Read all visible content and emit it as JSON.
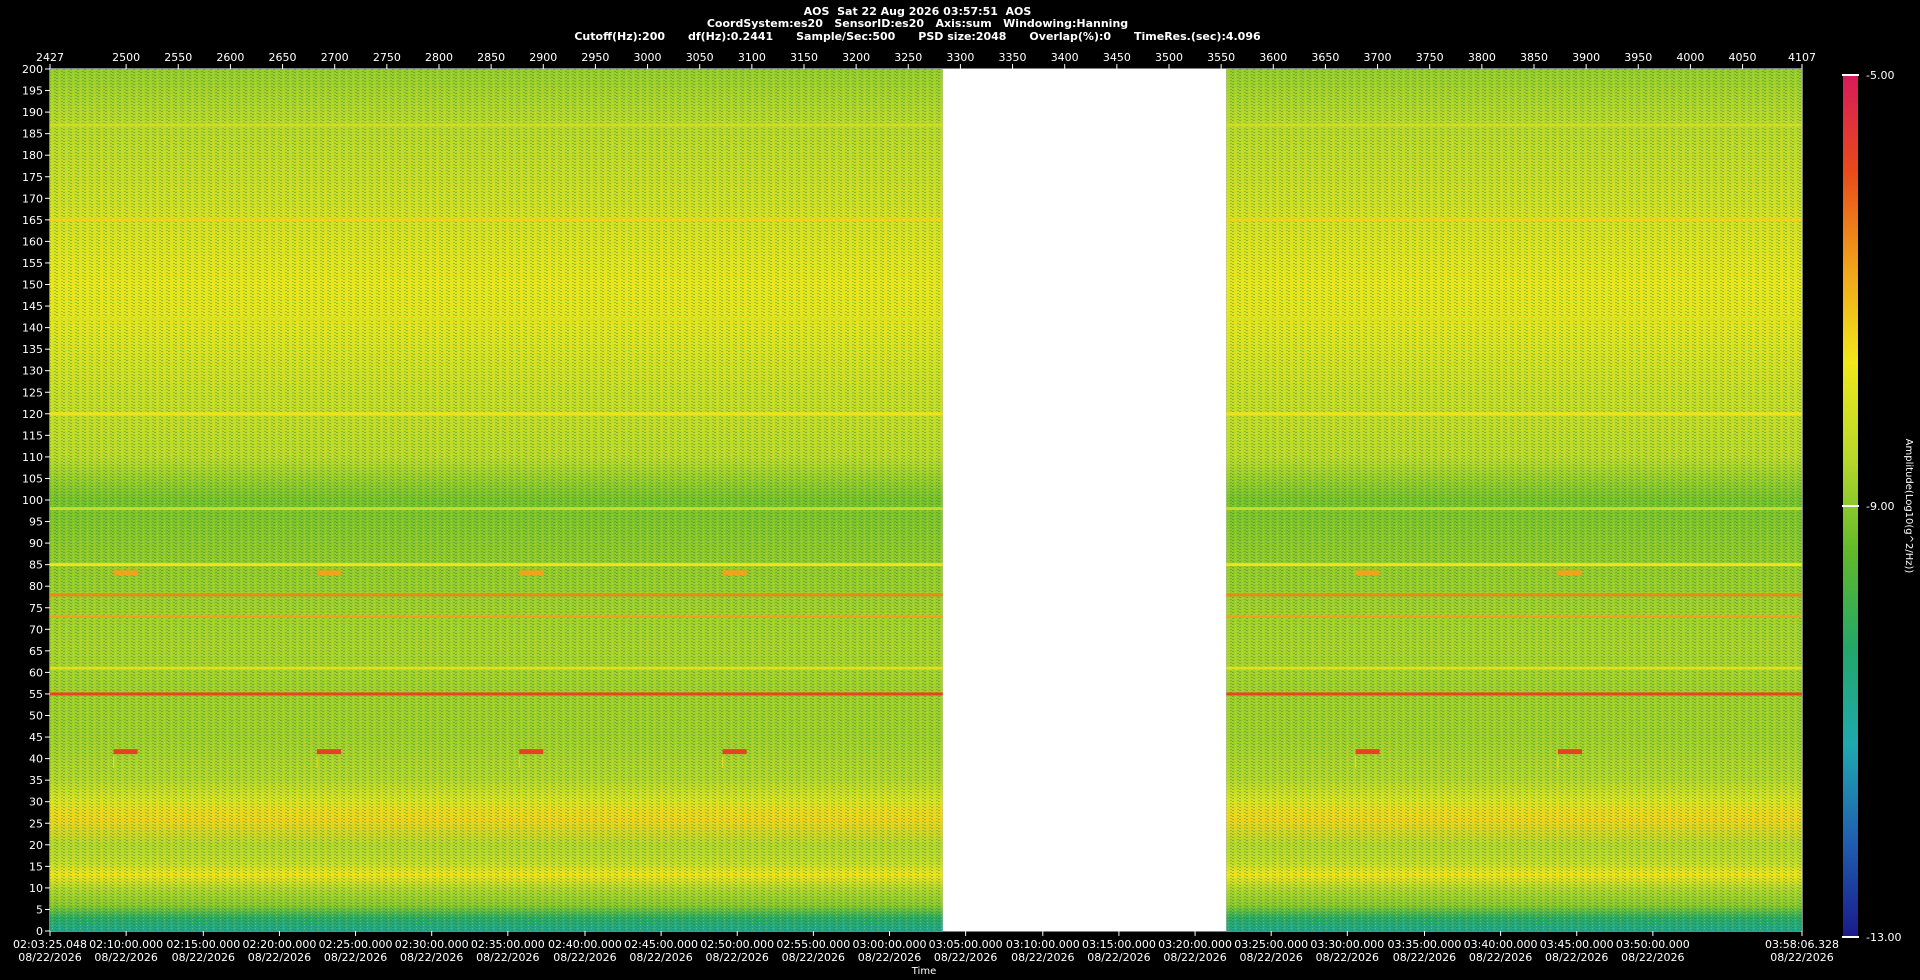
{
  "header": {
    "line1": "AOS  Sat 22 Aug 2026 03:57:51  AOS",
    "line2": "CoordSystem:es20   SensorID:es20   Axis:sum   Windowing:Hanning",
    "line3": "Cutoff(Hz):200      df(Hz):0.2441      Sample/Sec:500      PSD size:2048      Overlap(%):0      TimeRes.(sec):4.096"
  },
  "chart_data": {
    "type": "heatmap",
    "title": "AOS  Sat 22 Aug 2026 03:57:51  AOS",
    "xlabel": "Time",
    "ylabel": "",
    "colorbar_label": "Amplitude(Log10(g^2/Hz))",
    "top_axis": {
      "range": [
        2427,
        4107
      ],
      "ticks": [
        2427,
        2500,
        2550,
        2600,
        2650,
        2700,
        2750,
        2800,
        2850,
        2900,
        2950,
        3000,
        3050,
        3100,
        3150,
        3200,
        3250,
        3300,
        3350,
        3400,
        3450,
        3500,
        3550,
        3600,
        3650,
        3700,
        3750,
        3800,
        3850,
        3900,
        3950,
        4000,
        4050,
        4107
      ]
    },
    "y_axis": {
      "range": [
        0,
        200
      ],
      "ticks": [
        0,
        5,
        10,
        15,
        20,
        25,
        30,
        35,
        40,
        45,
        50,
        55,
        60,
        65,
        70,
        75,
        80,
        85,
        90,
        95,
        100,
        105,
        110,
        115,
        120,
        125,
        130,
        135,
        140,
        145,
        150,
        155,
        160,
        165,
        170,
        175,
        180,
        185,
        190,
        195,
        200
      ]
    },
    "x_axis_labels": [
      {
        "frame": 2427,
        "time": "02:03:25.048",
        "date": "08/22/2026"
      },
      {
        "frame": 2500,
        "time": "02:10:00.000",
        "date": "08/22/2026"
      },
      {
        "frame": 2574,
        "time": "02:15:00.000",
        "date": "08/22/2026"
      },
      {
        "frame": 2647,
        "time": "02:20:00.000",
        "date": "08/22/2026"
      },
      {
        "frame": 2720,
        "time": "02:25:00.000",
        "date": "08/22/2026"
      },
      {
        "frame": 2793,
        "time": "02:30:00.000",
        "date": "08/22/2026"
      },
      {
        "frame": 2866,
        "time": "02:35:00.000",
        "date": "08/22/2026"
      },
      {
        "frame": 2940,
        "time": "02:40:00.000",
        "date": "08/22/2026"
      },
      {
        "frame": 3013,
        "time": "02:45:00.000",
        "date": "08/22/2026"
      },
      {
        "frame": 3086,
        "time": "02:50:00.000",
        "date": "08/22/2026"
      },
      {
        "frame": 3159,
        "time": "02:55:00.000",
        "date": "08/22/2026"
      },
      {
        "frame": 3232,
        "time": "03:00:00.000",
        "date": "08/22/2026"
      },
      {
        "frame": 3305,
        "time": "03:05:00.000",
        "date": "08/22/2026"
      },
      {
        "frame": 3379,
        "time": "03:10:00.000",
        "date": "08/22/2026"
      },
      {
        "frame": 3452,
        "time": "03:15:00.000",
        "date": "08/22/2026"
      },
      {
        "frame": 3525,
        "time": "03:20:00.000",
        "date": "08/22/2026"
      },
      {
        "frame": 3598,
        "time": "03:25:00.000",
        "date": "08/22/2026"
      },
      {
        "frame": 3671,
        "time": "03:30:00.000",
        "date": "08/22/2026"
      },
      {
        "frame": 3745,
        "time": "03:35:00.000",
        "date": "08/22/2026"
      },
      {
        "frame": 3818,
        "time": "03:40:00.000",
        "date": "08/22/2026"
      },
      {
        "frame": 3891,
        "time": "03:45:00.000",
        "date": "08/22/2026"
      },
      {
        "frame": 3964,
        "time": "03:50:00.000",
        "date": "08/22/2026"
      },
      {
        "frame": 4107,
        "time": "03:58:06.328",
        "date": "08/22/2026"
      }
    ],
    "data_gap_frames": [
      3283,
      3555
    ],
    "colorbar": {
      "range": [
        -13.0,
        -5.0
      ],
      "ticks": [
        {
          "v": -5.0,
          "label": "-5.00"
        },
        {
          "v": -9.0,
          "label": "-9.00"
        },
        {
          "v": -13.0,
          "label": "-13.00"
        }
      ],
      "colors": [
        "#1a1a8c",
        "#1f5fb0",
        "#1fa8b0",
        "#22a86a",
        "#5fb82a",
        "#b8d82a",
        "#f0e81a",
        "#f0a21a",
        "#e84a1a",
        "#d81a5a"
      ]
    },
    "tonal_lines_hz": [
      {
        "hz": 55,
        "level": -5.8
      },
      {
        "hz": 73,
        "level": -6.8
      },
      {
        "hz": 78,
        "level": -6.5
      },
      {
        "hz": 85,
        "level": -7.6
      },
      {
        "hz": 120,
        "level": -7.6
      },
      {
        "hz": 142,
        "level": -8.0
      },
      {
        "hz": 165,
        "level": -7.4
      },
      {
        "hz": 187,
        "level": -8.2
      },
      {
        "hz": 98,
        "level": -8.3
      },
      {
        "hz": 61,
        "level": -8.0
      }
    ],
    "periodic_bursts": [
      {
        "frame_start": 2488,
        "frame_end": 2511,
        "hz": [
          41.5,
          83
        ]
      },
      {
        "frame_start": 2683,
        "frame_end": 2706,
        "hz": [
          41.5,
          83
        ]
      },
      {
        "frame_start": 2877,
        "frame_end": 2900,
        "hz": [
          41.5,
          83
        ]
      },
      {
        "frame_start": 3072,
        "frame_end": 3095,
        "hz": [
          41.5,
          83
        ]
      },
      {
        "frame_start": 3679,
        "frame_end": 3702,
        "hz": [
          41.5,
          83
        ]
      },
      {
        "frame_start": 3873,
        "frame_end": 3896,
        "hz": [
          41.5,
          83
        ]
      }
    ]
  }
}
